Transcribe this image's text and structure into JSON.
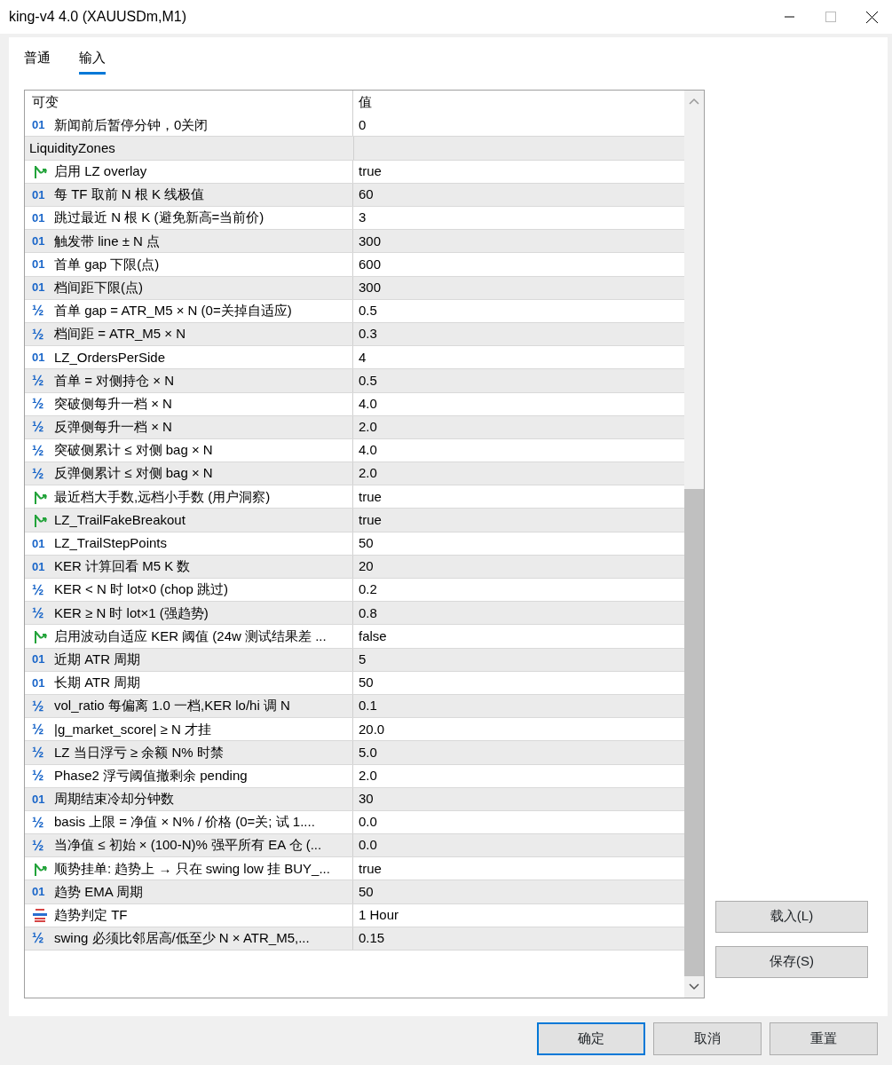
{
  "window": {
    "title": "king-v4 4.0 (XAUUSDm,M1)"
  },
  "tabs": [
    {
      "label": "普通",
      "selected": false
    },
    {
      "label": "输入",
      "selected": true
    }
  ],
  "table": {
    "columns": [
      "可变",
      "值"
    ],
    "rows": [
      {
        "kind": "int",
        "icon": "01",
        "name": "新闻前后暂停分钟，0关闭",
        "value": "0"
      },
      {
        "kind": "group",
        "name": "LiquidityZones"
      },
      {
        "kind": "bool",
        "name": "启用 LZ overlay",
        "value": "true"
      },
      {
        "kind": "int",
        "icon": "01",
        "name": "每 TF 取前 N 根 K 线极值",
        "value": "60"
      },
      {
        "kind": "int",
        "icon": "01",
        "name": "跳过最近 N 根 K (避免新高=当前价)",
        "value": "3"
      },
      {
        "kind": "int",
        "icon": "01",
        "name": "触发带 line ± N 点",
        "value": "300"
      },
      {
        "kind": "int",
        "icon": "01",
        "name": "首单 gap 下限(点)",
        "value": "600"
      },
      {
        "kind": "int",
        "icon": "01",
        "name": "档间距下限(点)",
        "value": "300"
      },
      {
        "kind": "double",
        "icon": "½",
        "name": "首单 gap = ATR_M5 × N (0=关掉自适应)",
        "value": "0.5"
      },
      {
        "kind": "double",
        "icon": "½",
        "name": "档间距 = ATR_M5 × N",
        "value": "0.3"
      },
      {
        "kind": "int",
        "icon": "01",
        "name": "LZ_OrdersPerSide",
        "value": "4"
      },
      {
        "kind": "double",
        "icon": "½",
        "name": "首单 = 对侧持仓 × N",
        "value": "0.5"
      },
      {
        "kind": "double",
        "icon": "½",
        "name": "突破侧每升一档 × N",
        "value": "4.0"
      },
      {
        "kind": "double",
        "icon": "½",
        "name": "反弹侧每升一档 × N",
        "value": "2.0"
      },
      {
        "kind": "double",
        "icon": "½",
        "name": "突破侧累计 ≤ 对侧 bag × N",
        "value": "4.0"
      },
      {
        "kind": "double",
        "icon": "½",
        "name": "反弹侧累计 ≤ 对侧 bag × N",
        "value": "2.0"
      },
      {
        "kind": "bool",
        "name": "最近档大手数,远档小手数 (用户洞察)",
        "value": "true"
      },
      {
        "kind": "bool",
        "name": "LZ_TrailFakeBreakout",
        "value": "true"
      },
      {
        "kind": "int",
        "icon": "01",
        "name": "LZ_TrailStepPoints",
        "value": "50"
      },
      {
        "kind": "int",
        "icon": "01",
        "name": "KER 计算回看 M5 K 数",
        "value": "20"
      },
      {
        "kind": "double",
        "icon": "½",
        "name": "KER < N 时 lot×0 (chop 跳过)",
        "value": "0.2"
      },
      {
        "kind": "double",
        "icon": "½",
        "name": "KER ≥ N 时 lot×1 (强趋势)",
        "value": "0.8"
      },
      {
        "kind": "bool",
        "name": "启用波动自适应 KER 阈值 (24w 测试结果差 ...",
        "value": "false"
      },
      {
        "kind": "int",
        "icon": "01",
        "name": "近期 ATR 周期",
        "value": "5"
      },
      {
        "kind": "int",
        "icon": "01",
        "name": "长期 ATR 周期",
        "value": "50"
      },
      {
        "kind": "double",
        "icon": "½",
        "name": "vol_ratio 每偏离 1.0 一档,KER lo/hi 调 N",
        "value": "0.1"
      },
      {
        "kind": "double",
        "icon": "½",
        "name": "|g_market_score| ≥ N 才挂",
        "value": "20.0"
      },
      {
        "kind": "double",
        "icon": "½",
        "name": "LZ 当日浮亏 ≥ 余额 N% 时禁",
        "value": "5.0"
      },
      {
        "kind": "double",
        "icon": "½",
        "name": "Phase2 浮亏阈值撤剩余 pending",
        "value": "2.0"
      },
      {
        "kind": "int",
        "icon": "01",
        "name": "周期结束冷却分钟数",
        "value": "30"
      },
      {
        "kind": "double",
        "icon": "½",
        "name": "basis 上限 = 净值 × N% / 价格 (0=关; 试 1....",
        "value": "0.0"
      },
      {
        "kind": "double",
        "icon": "½",
        "name": "当净值 ≤ 初始 × (100-N)% 强平所有 EA 仓 (...",
        "value": "0.0"
      },
      {
        "kind": "bool",
        "name": "顺势挂单: 趋势上 → 只在 swing low 挂 BUY_...",
        "value": "true"
      },
      {
        "kind": "int",
        "icon": "01",
        "name": "趋势 EMA 周期",
        "value": "50"
      },
      {
        "kind": "enum",
        "name": "趋势判定 TF",
        "value": "1 Hour"
      },
      {
        "kind": "double",
        "icon": "½",
        "name": "swing 必须比邻居高/低至少 N × ATR_M5,...",
        "value": "0.15"
      }
    ]
  },
  "side_buttons": [
    "载入(L)",
    "保存(S)"
  ],
  "footer_buttons": [
    {
      "label": "确定",
      "default": true
    },
    {
      "label": "取消",
      "default": false
    },
    {
      "label": "重置",
      "default": false
    }
  ]
}
